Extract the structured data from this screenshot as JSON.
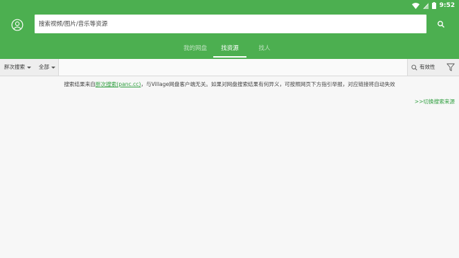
{
  "status_bar": {
    "time": "9:52"
  },
  "search": {
    "placeholder": "搜索视频/图片/音乐等资源"
  },
  "tabs": [
    {
      "label": "我的网盘"
    },
    {
      "label": "找资源"
    },
    {
      "label": "找人"
    }
  ],
  "filters": {
    "source_label": "胖次搜索",
    "category_label": "全部",
    "validity_label": "有效性"
  },
  "notice": {
    "prefix": "搜索结果来自",
    "link_text": "胖次搜索(panc.cc)",
    "suffix": "，与Village网盘客户端无关。如果对网盘搜索结果有何异义，可按照网页下方指引举报，对应链接将自动失效"
  },
  "switch_source_label": ">>切换搜索来源",
  "colors": {
    "primary": "#4caf50",
    "link": "#2e9e3e"
  }
}
